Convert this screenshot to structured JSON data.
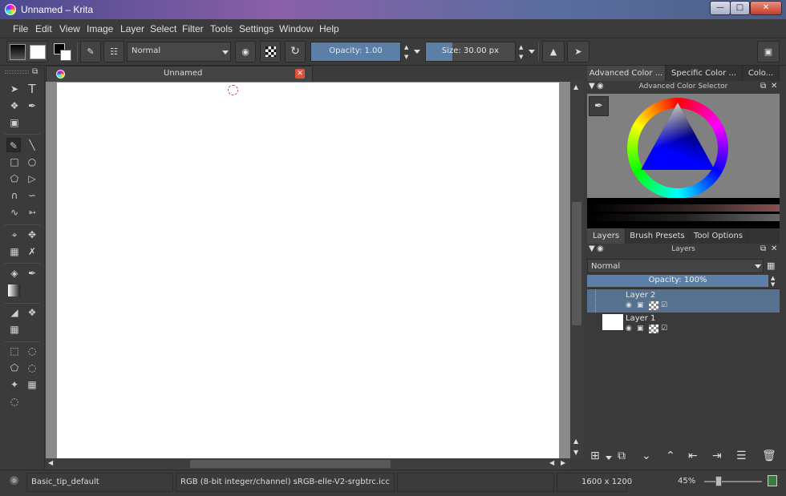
{
  "window": {
    "title": "Unnamed – Krita",
    "controls": {
      "minimize": "—",
      "maximize": "□",
      "close": "✕"
    }
  },
  "menu": [
    "File",
    "Edit",
    "View",
    "Image",
    "Layer",
    "Select",
    "Filter",
    "Tools",
    "Settings",
    "Window",
    "Help"
  ],
  "toolbar": {
    "blend_mode": "Normal",
    "opacity_label": "Opacity:",
    "opacity_value": "1.00",
    "opacity_fraction": 1.0,
    "size_label": "Size:",
    "size_value": "30.00 px",
    "size_fraction": 0.3,
    "icons": [
      "gradient-swatch-icon",
      "fg-bg-color-icon",
      "brush-preset-icon",
      "pattern-icon",
      "eraser-icon",
      "preserve-alpha-icon",
      "reload-preset-icon",
      "mirror-horizontal-icon",
      "mirror-vertical-icon",
      "workspace-icon"
    ]
  },
  "colors": {
    "background": "#3b3b3b",
    "accent": "#5b7fa6",
    "selection": "#56728f",
    "canvas": "#ffffff",
    "close_red": "#e0533a"
  },
  "document": {
    "tab_title": "Unnamed",
    "close": "✕"
  },
  "dockers": {
    "color_tabs": [
      "Advanced Color ...",
      "Specific Color ...",
      "Colo..."
    ],
    "color_header": "Advanced Color Selector",
    "layer_tabs": [
      "Layers",
      "Brush Presets",
      "Tool Options"
    ],
    "layers_header": "Layers",
    "layers_blend": "Normal",
    "layers_opacity": "Opacity:  100%",
    "layers": [
      {
        "name": "Layer 2",
        "selected": true
      },
      {
        "name": "Layer 1",
        "selected": false
      }
    ]
  },
  "status": {
    "brush": "Basic_tip_default",
    "color_space": "RGB (8-bit integer/channel)  sRGB-elle-V2-srgbtrc.icc",
    "image_size": "1600 x 1200",
    "zoom": "45%"
  }
}
